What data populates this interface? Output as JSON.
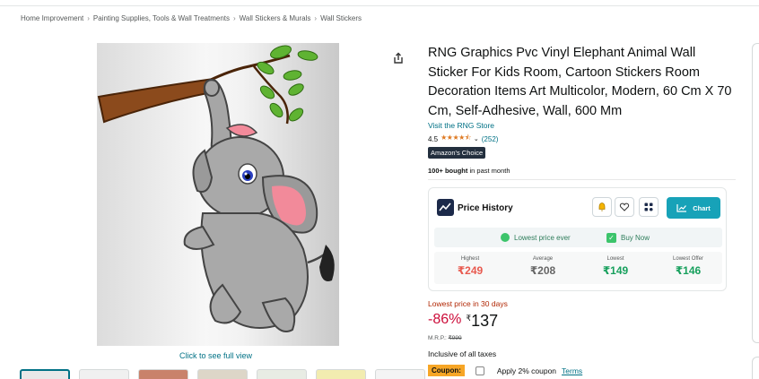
{
  "breadcrumb": [
    "Home Improvement",
    "Painting Supplies, Tools & Wall Treatments",
    "Wall Stickers & Murals",
    "Wall Stickers"
  ],
  "breadcrumb_sep": "›",
  "gallery": {
    "full_view_label": "Click to see full view"
  },
  "product": {
    "title": "RNG Graphics Pvc Vinyl Elephant Animal Wall Sticker For Kids Room, Cartoon Stickers Room Decoration Items Art Multicolor, Modern, 60 Cm X 70 Cm, Self-Adhesive, Wall, 600 Mm",
    "store_link": "Visit the RNG Store",
    "rating": "4.5",
    "stars": "★★★★⯪",
    "review_count": "(252)",
    "badge": "Amazon's Choice",
    "bought_bold": "100+ bought",
    "bought_rest": " in past month"
  },
  "price_history": {
    "title": "Price History",
    "chart_button": "Chart",
    "lowest_ever": "Lowest price ever",
    "buy_now": "Buy Now",
    "stats": [
      {
        "label": "Highest",
        "value": "₹249",
        "tone": "red"
      },
      {
        "label": "Average",
        "value": "₹208",
        "tone": "grey"
      },
      {
        "label": "Lowest",
        "value": "₹149",
        "tone": "green"
      },
      {
        "label": "Lowest Offer",
        "value": "₹146",
        "tone": "green"
      }
    ]
  },
  "pricing": {
    "lowest_30": "Lowest price in 30 days",
    "discount": "-86%",
    "currency": "₹",
    "price": "137",
    "mrp_label": "M.R.P.:",
    "mrp_value": "₹999",
    "inclusive": "Inclusive of all taxes",
    "coupon_tag": "Coupon:",
    "coupon_text": "Apply 2% coupon",
    "terms": "Terms"
  },
  "colors": {
    "accent": "#17a2b8",
    "link": "#007185",
    "deal_red": "#cc0c39",
    "badge_bg": "#232f3e",
    "coupon": "#f7a626"
  },
  "icons": [
    "share-icon",
    "bell-icon",
    "heart-icon",
    "apps-icon",
    "chart-line-icon",
    "star-icon",
    "check-icon"
  ]
}
